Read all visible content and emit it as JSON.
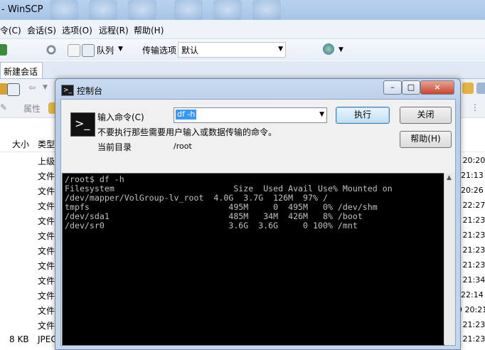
{
  "app": {
    "title": "- WinSCP"
  },
  "menu": {
    "items": [
      "令(C)",
      "会话(S)",
      "选项(O)",
      "远程(R)",
      "帮助(H)"
    ]
  },
  "toolbar": {
    "queue_label": "队列",
    "transfer_label": "传输选项",
    "transfer_value": "默认"
  },
  "tabs": {
    "new_session": "新建会话"
  },
  "toolbar3": {
    "properties_label": "属性"
  },
  "file_columns": {
    "size": "大小",
    "type": "类型"
  },
  "file_types": [
    "上级",
    "文件",
    "文件",
    "文件",
    "文件",
    "文件",
    "文件",
    "文件",
    "文件",
    "文件",
    "文件",
    "文件",
    "JPEG"
  ],
  "file_dates": [
    "3 20:20",
    "21:13",
    "20:26",
    "5 22:27",
    "8 21:23",
    "8 21:23",
    "3 21:23",
    "3 21:23",
    "0 21:34",
    "22:14",
    "19 20:21",
    "8 21:23",
    "8 21:23",
    "8 21:23"
  ],
  "last_size": "8 KB",
  "dialog": {
    "title": "控制台",
    "command_label": "输入命令(C)",
    "command_value": "df -h",
    "warning": "不要执行那些需要用户输入或数据传输的命令。",
    "current_dir_label": "当前目录",
    "current_dir_value": "/root",
    "execute_button": "执行",
    "close_button": "关闭",
    "help_button": "帮助(H)",
    "window_buttons": {
      "minimize": "–",
      "maximize": "□",
      "close": "×"
    }
  },
  "terminal": {
    "lines": [
      "/root$ df -h",
      "Filesystem                        Size  Used Avail Use% Mounted on",
      "/dev/mapper/VolGroup-lv_root  4.0G  3.7G  126M  97% /",
      "tmpfs                            495M     0  495M   0% /dev/shm",
      "/dev/sda1                        485M   34M  426M   8% /boot",
      "/dev/sr0                         3.6G  3.6G     0 100% /mnt"
    ]
  }
}
